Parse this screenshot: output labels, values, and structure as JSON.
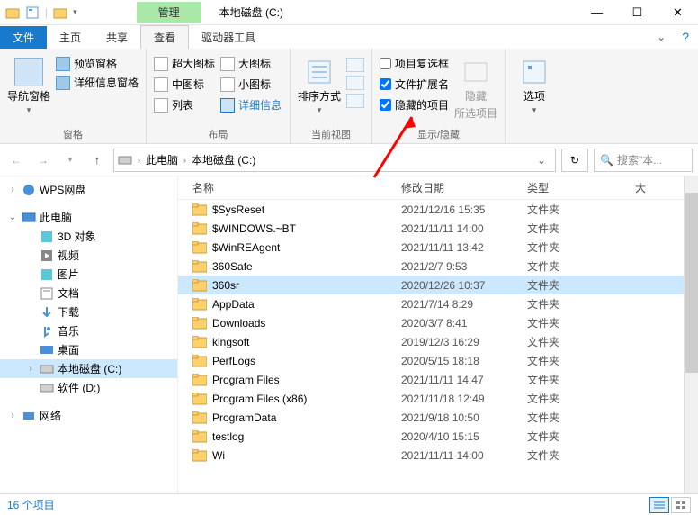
{
  "title": "本地磁盘 (C:)",
  "tabs": {
    "tools_label": "管理",
    "file": "文件",
    "home": "主页",
    "share": "共享",
    "view": "查看",
    "drive_tools": "驱动器工具"
  },
  "ribbon": {
    "panes": {
      "label": "窗格",
      "nav": "导航窗格",
      "preview": "预览窗格",
      "details": "详细信息窗格"
    },
    "layout": {
      "label": "布局",
      "xl": "超大图标",
      "large": "大图标",
      "medium": "中图标",
      "small": "小图标",
      "list": "列表",
      "details": "详细信息"
    },
    "current_view": {
      "label": "当前视图",
      "sort": "排序方式"
    },
    "show_hide": {
      "label": "显示/隐藏",
      "item_checkboxes": "项目复选框",
      "file_ext": "文件扩展名",
      "hidden_items": "隐藏的项目",
      "hide": "隐藏",
      "selected": "所选项目"
    },
    "options": "选项"
  },
  "breadcrumb": {
    "this_pc": "此电脑",
    "drive": "本地磁盘 (C:)"
  },
  "search": {
    "placeholder": "搜索\"本..."
  },
  "sidebar": {
    "wps": "WPS网盘",
    "this_pc": "此电脑",
    "items": [
      "3D 对象",
      "视频",
      "图片",
      "文档",
      "下载",
      "音乐",
      "桌面",
      "本地磁盘 (C:)",
      "软件 (D:)"
    ],
    "network": "网络"
  },
  "columns": {
    "name": "名称",
    "date": "修改日期",
    "type": "类型",
    "size": "大"
  },
  "files": [
    {
      "name": "$SysReset",
      "date": "2021/12/16 15:35",
      "type": "文件夹"
    },
    {
      "name": "$WINDOWS.~BT",
      "date": "2021/11/11 14:00",
      "type": "文件夹"
    },
    {
      "name": "$WinREAgent",
      "date": "2021/11/11 13:42",
      "type": "文件夹"
    },
    {
      "name": "360Safe",
      "date": "2021/2/7 9:53",
      "type": "文件夹"
    },
    {
      "name": "360sr",
      "date": "2020/12/26 10:37",
      "type": "文件夹",
      "selected": true
    },
    {
      "name": "AppData",
      "date": "2021/7/14 8:29",
      "type": "文件夹"
    },
    {
      "name": "Downloads",
      "date": "2020/3/7 8:41",
      "type": "文件夹"
    },
    {
      "name": "kingsoft",
      "date": "2019/12/3 16:29",
      "type": "文件夹"
    },
    {
      "name": "PerfLogs",
      "date": "2020/5/15 18:18",
      "type": "文件夹"
    },
    {
      "name": "Program Files",
      "date": "2021/11/11 14:47",
      "type": "文件夹"
    },
    {
      "name": "Program Files (x86)",
      "date": "2021/11/18 12:49",
      "type": "文件夹"
    },
    {
      "name": "ProgramData",
      "date": "2021/9/18 10:50",
      "type": "文件夹"
    },
    {
      "name": "testlog",
      "date": "2020/4/10 15:15",
      "type": "文件夹"
    },
    {
      "name": "Wi",
      "date": "2021/11/11 14:00",
      "type": "文件夹"
    }
  ],
  "status": {
    "count": "16 个项目"
  }
}
